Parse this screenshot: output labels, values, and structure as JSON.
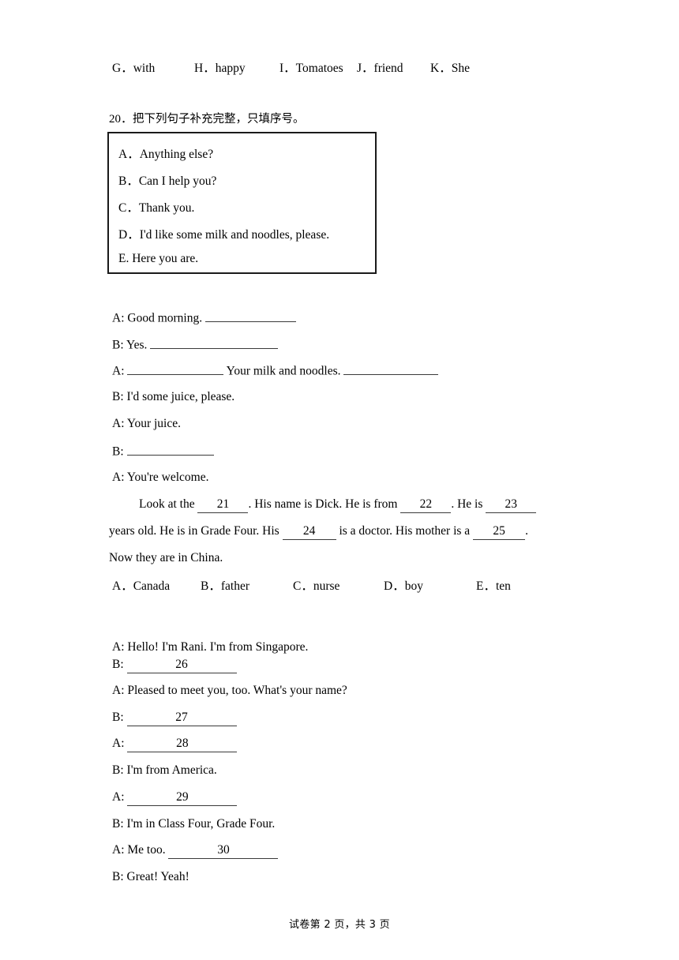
{
  "page": {
    "footer": "试卷第 2 页，共 3 页"
  },
  "word_bank_top": {
    "options": [
      {
        "label": "G．",
        "word": "with"
      },
      {
        "label": "H．",
        "word": "happy"
      },
      {
        "label": "I．",
        "word": "Tomatoes"
      },
      {
        "label": "J．",
        "word": "friend"
      },
      {
        "label": "K．",
        "word": "She"
      }
    ]
  },
  "question20": {
    "number": "20．",
    "prompt": "把下列句子补充完整，只填序号。",
    "choices": [
      "A．Anything else?",
      "B．Can I help you?",
      "C．Thank you.",
      "D．I'd like some milk and noodles, please.",
      "E. Here you are."
    ],
    "dialogue": [
      {
        "speaker": "A: ",
        "text": "Good morning. ",
        "blank_after": true
      },
      {
        "speaker": "B: ",
        "text": "Yes. ",
        "blank_after": true
      },
      {
        "speaker": "A: ",
        "text": " Your milk and noodles. ",
        "blank_before": true,
        "blank_after": true
      },
      {
        "speaker": "B: ",
        "text": "I'd some juice, please.",
        "blank_after": false
      },
      {
        "speaker": "A: ",
        "text": "Your juice.",
        "blank_after": false
      },
      {
        "speaker": "B: ",
        "text": "",
        "blank_after": true
      },
      {
        "speaker": "A: ",
        "text": "You're welcome.",
        "blank_after": false
      }
    ]
  },
  "cloze_21_25": {
    "line1_part1": "Look at the ",
    "blank21": "21",
    "line1_part2": ". His name is Dick. He is from ",
    "blank22": "22",
    "line1_part3": ". He is ",
    "blank23": "23",
    "line2_part1": "years old. He is in Grade Four. His ",
    "blank24": "24",
    "line2_part2": " is a doctor. His mother is a ",
    "blank25": "25",
    "line2_part3": ".",
    "line3": "Now they are in China.",
    "options": [
      {
        "label": "A．",
        "word": "Canada"
      },
      {
        "label": "B．",
        "word": "father"
      },
      {
        "label": "C．",
        "word": "nurse"
      },
      {
        "label": "D．",
        "word": "boy"
      },
      {
        "label": "E．",
        "word": "ten"
      }
    ]
  },
  "dialogue_26_30": {
    "lines": [
      {
        "speaker": "A: ",
        "text": "Hello! I'm Rani. I'm from Singapore.",
        "blank": null
      },
      {
        "speaker": "B: ",
        "text": "",
        "blank": "26"
      },
      {
        "speaker": "A: ",
        "text": "Pleased to meet you, too. What's your name?",
        "blank": null
      },
      {
        "speaker": "B: ",
        "text": "",
        "blank": "27"
      },
      {
        "speaker": "A: ",
        "text": "",
        "blank": "28"
      },
      {
        "speaker": "B: ",
        "text": "I'm from America.",
        "blank": null
      },
      {
        "speaker": "A: ",
        "text": "",
        "blank": "29"
      },
      {
        "speaker": "B: ",
        "text": "I'm in Class Four, Grade Four.",
        "blank": null
      },
      {
        "speaker": "A: ",
        "text": "Me too. ",
        "blank": "30"
      },
      {
        "speaker": "B: ",
        "text": "Great! Yeah!",
        "blank": null
      }
    ]
  }
}
